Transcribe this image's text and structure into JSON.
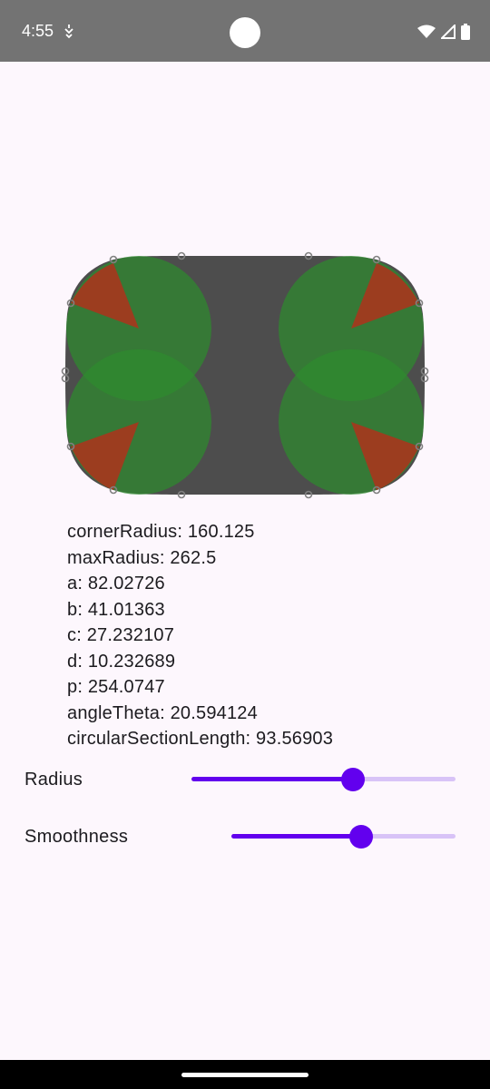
{
  "status_bar": {
    "time": "4:55",
    "icons": [
      "notification-icon",
      "wifi-icon",
      "cellular-signal-icon",
      "battery-icon"
    ]
  },
  "shape_preview": {
    "colors": {
      "shape_fill": "#4d4d4d",
      "corner_circle": "#2e8b2e",
      "corner_wedge": "#9c3d1f",
      "control_point": "#808080"
    }
  },
  "info": {
    "corner_radius": "cornerRadius: 160.125",
    "max_radius": "maxRadius: 262.5",
    "a": "a: 82.02726",
    "b": "b: 41.01363",
    "c": "c: 27.232107",
    "d": "d: 10.232689",
    "p": "p: 254.0747",
    "angle_theta": "angleTheta: 20.594124",
    "circular_section_length": "circularSectionLength: 93.56903"
  },
  "controls": {
    "radius": {
      "label": "Radius",
      "value": 0.61
    },
    "smoothness": {
      "label": "Smoothness",
      "value": 0.58
    }
  },
  "theme": {
    "accent": "#6200ee",
    "accent_light": "#d8c3f7",
    "background": "#fdf7fd"
  }
}
